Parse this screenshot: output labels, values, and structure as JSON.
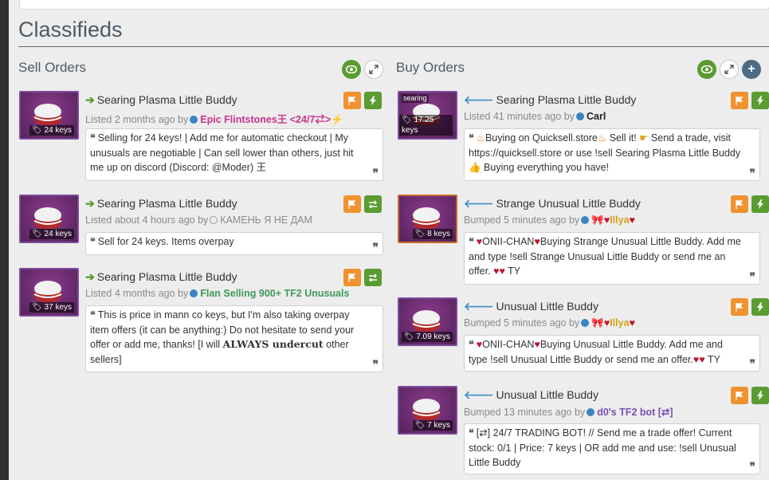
{
  "page": {
    "title": "Classifieds"
  },
  "sell": {
    "title": "Sell Orders",
    "listings": [
      {
        "name": "Searing Plasma Little Buddy",
        "price": "24 keys",
        "status": "Listed 2 months ago by",
        "user": "Epic Flintstones王 <24/7⇄>⚡",
        "user_color": "#c8338e",
        "comment": "Selling for 24 keys! | Add me for automatic checkout | My unusuals are negotiable | Can sell lower than others, just hit me up on discord (Discord: @Moder) 王"
      },
      {
        "name": "Searing Plasma Little Buddy",
        "price": "24 keys",
        "status": "Listed about 4 hours ago by",
        "user": "КАМЕНЬ Я НЕ ДАМ",
        "user_color": "#8a8a8a",
        "comment": "Sell for 24 keys. Items overpay"
      },
      {
        "name": "Searing Plasma Little Buddy",
        "price": "37 keys",
        "status": "Listed 4 months ago by",
        "user": "Flan Selling 900+ TF2 Unusuals",
        "user_color": "#3f9a5a",
        "comment_a": "This is price in mann co keys, but I'm also taking overpay item offers (it can be anything:) Do not hesitate to send your offer or add me, thanks! [I will ",
        "comment_bold": "ALWAYS undercut",
        "comment_b": " other sellers]"
      }
    ]
  },
  "buy": {
    "title": "Buy Orders",
    "listings": [
      {
        "name": "Searing Plasma Little Buddy",
        "effect": "searing",
        "price": "17.25 keys",
        "status": "Listed 41 minutes ago by",
        "user": "Carl",
        "user_color": "#222222",
        "comment_1": "Buying on Quicksell.store",
        "comment_2": " Sell it! ",
        "comment_3": " Send a trade, visit https://quicksell.store or use !sell Searing Plasma Little Buddy ",
        "comment_4": " Buying everything you have!"
      },
      {
        "name": "Strange Unusual Little Buddy",
        "price": "8 keys",
        "status": "Bumped 5 minutes ago by",
        "user": "Illya",
        "user_color": "#d4a21a",
        "comment_1": "ONII-CHAN",
        "comment_2": "Buying Strange Unusual Little Buddy. Add me and type !sell Strange Unusual Little Buddy or send me an offer.",
        "comment_3": "TY"
      },
      {
        "name": "Unusual Little Buddy",
        "price": "7.09 keys",
        "status": "Bumped 5 minutes ago by",
        "user": "Illya",
        "user_color": "#d4a21a",
        "comment_1": "ONII-CHAN",
        "comment_2": "Buying Unusual Little Buddy. Add me and type !sell Unusual Little Buddy or send me an offer.",
        "comment_3": "TY"
      },
      {
        "name": "Unusual Little Buddy",
        "price": "7 keys",
        "status": "Bumped 13 minutes ago by",
        "user": "d0's TF2 bot [⇄]",
        "user_color": "#7a4fb5",
        "comment": "[⇄] 24/7 TRADING BOT! // Send me a trade offer! Current stock: 0/1 | Price: 7 keys | OR add me and use: !sell Unusual Little Buddy"
      }
    ]
  }
}
